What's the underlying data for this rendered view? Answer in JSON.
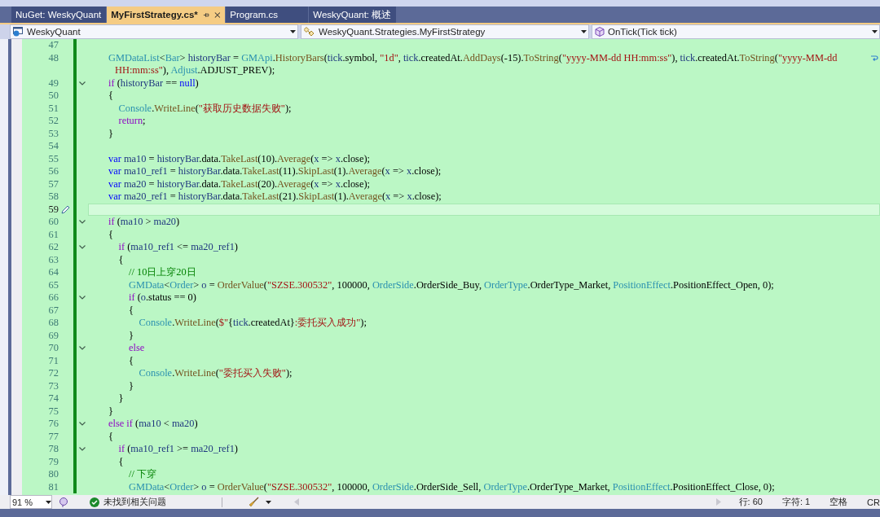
{
  "tabs": [
    {
      "label": "NuGet: WeskyQuant",
      "selected": false
    },
    {
      "label": "MyFirstStrategy.cs*",
      "selected": true
    },
    {
      "label": "Program.cs",
      "selected": false
    },
    {
      "label": "WeskyQuant: 概述",
      "selected": false
    }
  ],
  "nav_bar": {
    "project": "WeskyQuant",
    "type": "WeskyQuant.Strategies.MyFirstStrategy",
    "member": "OnTick(Tick tick)"
  },
  "editor": {
    "lines": [
      {
        "number": "47",
        "fold": false,
        "current": false
      },
      {
        "number": "48",
        "fold": false,
        "current": false,
        "tokens": [
          {
            "kind": "type",
            "text": "GMDataList"
          },
          {
            "kind": "plain",
            "text": "<"
          },
          {
            "kind": "type",
            "text": "Bar"
          },
          {
            "kind": "plain",
            "text": "> "
          },
          {
            "kind": "local",
            "text": "historyBar"
          },
          {
            "kind": "plain",
            "text": " = "
          },
          {
            "kind": "type",
            "text": "GMApi"
          },
          {
            "kind": "plain",
            "text": "."
          },
          {
            "kind": "method",
            "text": "HistoryBars"
          },
          {
            "kind": "plain",
            "text": "("
          },
          {
            "kind": "local",
            "text": "tick"
          },
          {
            "kind": "plain",
            "text": ".symbol, "
          },
          {
            "kind": "str",
            "text": "\"1d\""
          },
          {
            "kind": "plain",
            "text": ", "
          },
          {
            "kind": "local",
            "text": "tick"
          },
          {
            "kind": "plain",
            "text": ".createdAt."
          },
          {
            "kind": "method",
            "text": "AddDays"
          },
          {
            "kind": "plain",
            "text": "(-15)."
          },
          {
            "kind": "method",
            "text": "ToString"
          },
          {
            "kind": "plain",
            "text": "("
          },
          {
            "kind": "str",
            "text": "\"yyyy-MM-dd HH:mm:ss\""
          },
          {
            "kind": "plain",
            "text": "), "
          },
          {
            "kind": "local",
            "text": "tick"
          },
          {
            "kind": "plain",
            "text": ".createdAt."
          },
          {
            "kind": "method",
            "text": "ToString"
          },
          {
            "kind": "plain",
            "text": "("
          },
          {
            "kind": "str",
            "text": "\"yyyy-MM-dd"
          }
        ],
        "continuation": [
          {
            "kind": "str",
            "text": "HH:mm:ss\""
          },
          {
            "kind": "plain",
            "text": "), "
          },
          {
            "kind": "type",
            "text": "Adjust"
          },
          {
            "kind": "plain",
            "text": ".ADJUST_PREV);"
          }
        ]
      },
      {
        "number": "49",
        "fold": true,
        "current": false,
        "tokens": [
          {
            "kind": "ctrl",
            "text": "if"
          },
          {
            "kind": "plain",
            "text": " ("
          },
          {
            "kind": "local",
            "text": "historyBar"
          },
          {
            "kind": "plain",
            "text": " == "
          },
          {
            "kind": "kw",
            "text": "null"
          },
          {
            "kind": "plain",
            "text": ")"
          }
        ]
      },
      {
        "number": "50",
        "fold": false,
        "current": false,
        "tokens": [
          {
            "kind": "plain",
            "text": "{"
          }
        ],
        "children": [
          {
            "number": "51",
            "fold": false,
            "current": false,
            "tokens": [
              {
                "kind": "type",
                "text": "Console"
              },
              {
                "kind": "plain",
                "text": "."
              },
              {
                "kind": "method",
                "text": "WriteLine"
              },
              {
                "kind": "plain",
                "text": "("
              },
              {
                "kind": "str",
                "text": "\"获取历史数据失败\""
              },
              {
                "kind": "plain",
                "text": ");"
              }
            ]
          },
          {
            "number": "52",
            "fold": false,
            "current": false,
            "tokens": [
              {
                "kind": "ctrl",
                "text": "return"
              },
              {
                "kind": "plain",
                "text": ";"
              }
            ]
          }
        ]
      },
      {
        "number": "53",
        "fold": false,
        "current": false,
        "tokens": [
          {
            "kind": "plain",
            "text": "}"
          }
        ]
      },
      {
        "number": "54",
        "fold": false,
        "current": false
      },
      {
        "number": "55",
        "fold": false,
        "current": false,
        "tokens": [
          {
            "kind": "kw",
            "text": "var "
          },
          {
            "kind": "local",
            "text": "ma10"
          },
          {
            "kind": "plain",
            "text": " = "
          },
          {
            "kind": "local",
            "text": "historyBar"
          },
          {
            "kind": "plain",
            "text": ".data."
          },
          {
            "kind": "method",
            "text": "TakeLast"
          },
          {
            "kind": "plain",
            "text": "(10)."
          },
          {
            "kind": "method",
            "text": "Average"
          },
          {
            "kind": "plain",
            "text": "("
          },
          {
            "kind": "local",
            "text": "x"
          },
          {
            "kind": "plain",
            "text": " => "
          },
          {
            "kind": "local",
            "text": "x"
          },
          {
            "kind": "plain",
            "text": ".close);"
          }
        ]
      },
      {
        "number": "56",
        "fold": false,
        "current": false,
        "tokens": [
          {
            "kind": "kw",
            "text": "var "
          },
          {
            "kind": "local",
            "text": "ma10_ref1"
          },
          {
            "kind": "plain",
            "text": " = "
          },
          {
            "kind": "local",
            "text": "historyBar"
          },
          {
            "kind": "plain",
            "text": ".data."
          },
          {
            "kind": "method",
            "text": "TakeLast"
          },
          {
            "kind": "plain",
            "text": "(11)."
          },
          {
            "kind": "method",
            "text": "SkipLast"
          },
          {
            "kind": "plain",
            "text": "(1)."
          },
          {
            "kind": "method",
            "text": "Average"
          },
          {
            "kind": "plain",
            "text": "("
          },
          {
            "kind": "local",
            "text": "x"
          },
          {
            "kind": "plain",
            "text": " => "
          },
          {
            "kind": "local",
            "text": "x"
          },
          {
            "kind": "plain",
            "text": ".close);"
          }
        ]
      },
      {
        "number": "57",
        "fold": false,
        "current": false,
        "tokens": [
          {
            "kind": "kw",
            "text": "var "
          },
          {
            "kind": "local",
            "text": "ma20"
          },
          {
            "kind": "plain",
            "text": " = "
          },
          {
            "kind": "local",
            "text": "historyBar"
          },
          {
            "kind": "plain",
            "text": ".data."
          },
          {
            "kind": "method",
            "text": "TakeLast"
          },
          {
            "kind": "plain",
            "text": "(20)."
          },
          {
            "kind": "method",
            "text": "Average"
          },
          {
            "kind": "plain",
            "text": "("
          },
          {
            "kind": "local",
            "text": "x"
          },
          {
            "kind": "plain",
            "text": " => "
          },
          {
            "kind": "local",
            "text": "x"
          },
          {
            "kind": "plain",
            "text": ".close);"
          }
        ]
      },
      {
        "number": "58",
        "fold": false,
        "current": false,
        "tokens": [
          {
            "kind": "kw",
            "text": "var "
          },
          {
            "kind": "local",
            "text": "ma20_ref1"
          },
          {
            "kind": "plain",
            "text": " = "
          },
          {
            "kind": "local",
            "text": "historyBar"
          },
          {
            "kind": "plain",
            "text": ".data."
          },
          {
            "kind": "method",
            "text": "TakeLast"
          },
          {
            "kind": "plain",
            "text": "(21)."
          },
          {
            "kind": "method",
            "text": "SkipLast"
          },
          {
            "kind": "plain",
            "text": "(1)."
          },
          {
            "kind": "method",
            "text": "Average"
          },
          {
            "kind": "plain",
            "text": "("
          },
          {
            "kind": "local",
            "text": "x"
          },
          {
            "kind": "plain",
            "text": " => "
          },
          {
            "kind": "local",
            "text": "x"
          },
          {
            "kind": "plain",
            "text": ".close);"
          }
        ]
      },
      {
        "number": "59",
        "fold": false,
        "current": true
      },
      {
        "number": "60",
        "fold": true,
        "current": false,
        "tokens": [
          {
            "kind": "ctrl",
            "text": "if"
          },
          {
            "kind": "plain",
            "text": " ("
          },
          {
            "kind": "local",
            "text": "ma10"
          },
          {
            "kind": "plain",
            "text": " > "
          },
          {
            "kind": "local",
            "text": "ma20"
          },
          {
            "kind": "plain",
            "text": ")"
          }
        ]
      },
      {
        "number": "61",
        "fold": false,
        "current": false,
        "tokens": [
          {
            "kind": "plain",
            "text": "{"
          }
        ],
        "children": [
          {
            "number": "62",
            "fold": true,
            "current": false,
            "tokens": [
              {
                "kind": "ctrl",
                "text": "if"
              },
              {
                "kind": "plain",
                "text": " ("
              },
              {
                "kind": "local",
                "text": "ma10_ref1"
              },
              {
                "kind": "plain",
                "text": " <= "
              },
              {
                "kind": "local",
                "text": "ma20_ref1"
              },
              {
                "kind": "plain",
                "text": ")"
              }
            ]
          },
          {
            "number": "63",
            "fold": false,
            "current": false,
            "tokens": [
              {
                "kind": "plain",
                "text": "{"
              }
            ],
            "children": [
              {
                "number": "64",
                "fold": false,
                "current": false,
                "tokens": [
                  {
                    "kind": "comment",
                    "text": "// 10日上穿20日"
                  }
                ]
              },
              {
                "number": "65",
                "fold": false,
                "current": false,
                "tokens": [
                  {
                    "kind": "type",
                    "text": "GMData"
                  },
                  {
                    "kind": "plain",
                    "text": "<"
                  },
                  {
                    "kind": "type",
                    "text": "Order"
                  },
                  {
                    "kind": "plain",
                    "text": "> "
                  },
                  {
                    "kind": "local",
                    "text": "o"
                  },
                  {
                    "kind": "plain",
                    "text": " = "
                  },
                  {
                    "kind": "method",
                    "text": "OrderValue"
                  },
                  {
                    "kind": "plain",
                    "text": "("
                  },
                  {
                    "kind": "str",
                    "text": "\"SZSE.300532\""
                  },
                  {
                    "kind": "plain",
                    "text": ", 100000, "
                  },
                  {
                    "kind": "type",
                    "text": "OrderSide"
                  },
                  {
                    "kind": "plain",
                    "text": ".OrderSide_Buy, "
                  },
                  {
                    "kind": "type",
                    "text": "OrderType"
                  },
                  {
                    "kind": "plain",
                    "text": ".OrderType_Market, "
                  },
                  {
                    "kind": "type",
                    "text": "PositionEffect"
                  },
                  {
                    "kind": "plain",
                    "text": ".PositionEffect_Open, 0);"
                  }
                ]
              },
              {
                "number": "66",
                "fold": true,
                "current": false,
                "tokens": [
                  {
                    "kind": "ctrl",
                    "text": "if"
                  },
                  {
                    "kind": "plain",
                    "text": " ("
                  },
                  {
                    "kind": "local",
                    "text": "o"
                  },
                  {
                    "kind": "plain",
                    "text": ".status == 0)"
                  }
                ]
              },
              {
                "number": "67",
                "fold": false,
                "current": false,
                "tokens": [
                  {
                    "kind": "plain",
                    "text": "{"
                  }
                ],
                "children": [
                  {
                    "number": "68",
                    "fold": false,
                    "current": false,
                    "tokens": [
                      {
                        "kind": "type",
                        "text": "Console"
                      },
                      {
                        "kind": "plain",
                        "text": "."
                      },
                      {
                        "kind": "method",
                        "text": "WriteLine"
                      },
                      {
                        "kind": "plain",
                        "text": "("
                      },
                      {
                        "kind": "str",
                        "text": "$\""
                      },
                      {
                        "kind": "plain",
                        "text": "{"
                      },
                      {
                        "kind": "local",
                        "text": "tick"
                      },
                      {
                        "kind": "plain",
                        "text": ".createdAt}"
                      },
                      {
                        "kind": "str",
                        "text": ":委托买入成功\""
                      },
                      {
                        "kind": "plain",
                        "text": ");"
                      }
                    ]
                  }
                ]
              },
              {
                "number": "69",
                "fold": false,
                "current": false,
                "tokens": [
                  {
                    "kind": "plain",
                    "text": "}"
                  }
                ]
              },
              {
                "number": "70",
                "fold": true,
                "current": false,
                "tokens": [
                  {
                    "kind": "ctrl",
                    "text": "else"
                  }
                ]
              },
              {
                "number": "71",
                "fold": false,
                "current": false,
                "tokens": [
                  {
                    "kind": "plain",
                    "text": "{"
                  }
                ],
                "children": [
                  {
                    "number": "72",
                    "fold": false,
                    "current": false,
                    "tokens": [
                      {
                        "kind": "type",
                        "text": "Console"
                      },
                      {
                        "kind": "plain",
                        "text": "."
                      },
                      {
                        "kind": "method",
                        "text": "WriteLine"
                      },
                      {
                        "kind": "plain",
                        "text": "("
                      },
                      {
                        "kind": "str",
                        "text": "\"委托买入失败\""
                      },
                      {
                        "kind": "plain",
                        "text": ");"
                      }
                    ]
                  }
                ]
              },
              {
                "number": "73",
                "fold": false,
                "current": false,
                "tokens": [
                  {
                    "kind": "plain",
                    "text": "}"
                  }
                ]
              }
            ]
          },
          {
            "number": "74",
            "fold": false,
            "current": false,
            "tokens": [
              {
                "kind": "plain",
                "text": "}"
              }
            ]
          }
        ]
      },
      {
        "number": "75",
        "fold": false,
        "current": false,
        "tokens": [
          {
            "kind": "plain",
            "text": "}"
          }
        ]
      },
      {
        "number": "76",
        "fold": true,
        "current": false,
        "tokens": [
          {
            "kind": "ctrl",
            "text": "else if"
          },
          {
            "kind": "plain",
            "text": " ("
          },
          {
            "kind": "local",
            "text": "ma10"
          },
          {
            "kind": "plain",
            "text": " < "
          },
          {
            "kind": "local",
            "text": "ma20"
          },
          {
            "kind": "plain",
            "text": ")"
          }
        ]
      },
      {
        "number": "77",
        "fold": false,
        "current": false,
        "tokens": [
          {
            "kind": "plain",
            "text": "{"
          }
        ],
        "children": [
          {
            "number": "78",
            "fold": true,
            "current": false,
            "tokens": [
              {
                "kind": "ctrl",
                "text": "if"
              },
              {
                "kind": "plain",
                "text": " ("
              },
              {
                "kind": "local",
                "text": "ma10_ref1"
              },
              {
                "kind": "plain",
                "text": " >= "
              },
              {
                "kind": "local",
                "text": "ma20_ref1"
              },
              {
                "kind": "plain",
                "text": ")"
              }
            ]
          },
          {
            "number": "79",
            "fold": false,
            "current": false,
            "tokens": [
              {
                "kind": "plain",
                "text": "{"
              }
            ],
            "children": [
              {
                "number": "80",
                "fold": false,
                "current": false,
                "tokens": [
                  {
                    "kind": "comment",
                    "text": "// 下穿"
                  }
                ]
              },
              {
                "number": "81",
                "fold": false,
                "current": false,
                "tokens": [
                  {
                    "kind": "type",
                    "text": "GMData"
                  },
                  {
                    "kind": "plain",
                    "text": "<"
                  },
                  {
                    "kind": "type",
                    "text": "Order"
                  },
                  {
                    "kind": "plain",
                    "text": "> "
                  },
                  {
                    "kind": "local",
                    "text": "o"
                  },
                  {
                    "kind": "plain",
                    "text": " = "
                  },
                  {
                    "kind": "method",
                    "text": "OrderValue"
                  },
                  {
                    "kind": "plain",
                    "text": "("
                  },
                  {
                    "kind": "str",
                    "text": "\"SZSE.300532\""
                  },
                  {
                    "kind": "plain",
                    "text": ", 100000, "
                  },
                  {
                    "kind": "type",
                    "text": "OrderSide"
                  },
                  {
                    "kind": "plain",
                    "text": ".OrderSide_Sell, "
                  },
                  {
                    "kind": "type",
                    "text": "OrderType"
                  },
                  {
                    "kind": "plain",
                    "text": ".OrderType_Market, "
                  },
                  {
                    "kind": "type",
                    "text": "PositionEffect"
                  },
                  {
                    "kind": "plain",
                    "text": ".PositionEffect_Close, 0);"
                  }
                ]
              }
            ]
          }
        ]
      }
    ]
  },
  "status_bar": {
    "zoom": "91 %",
    "issues": "未找到相关问题",
    "line": "行: 60",
    "column": "字符: 1",
    "indent": "空格",
    "line_ending": "CR"
  }
}
